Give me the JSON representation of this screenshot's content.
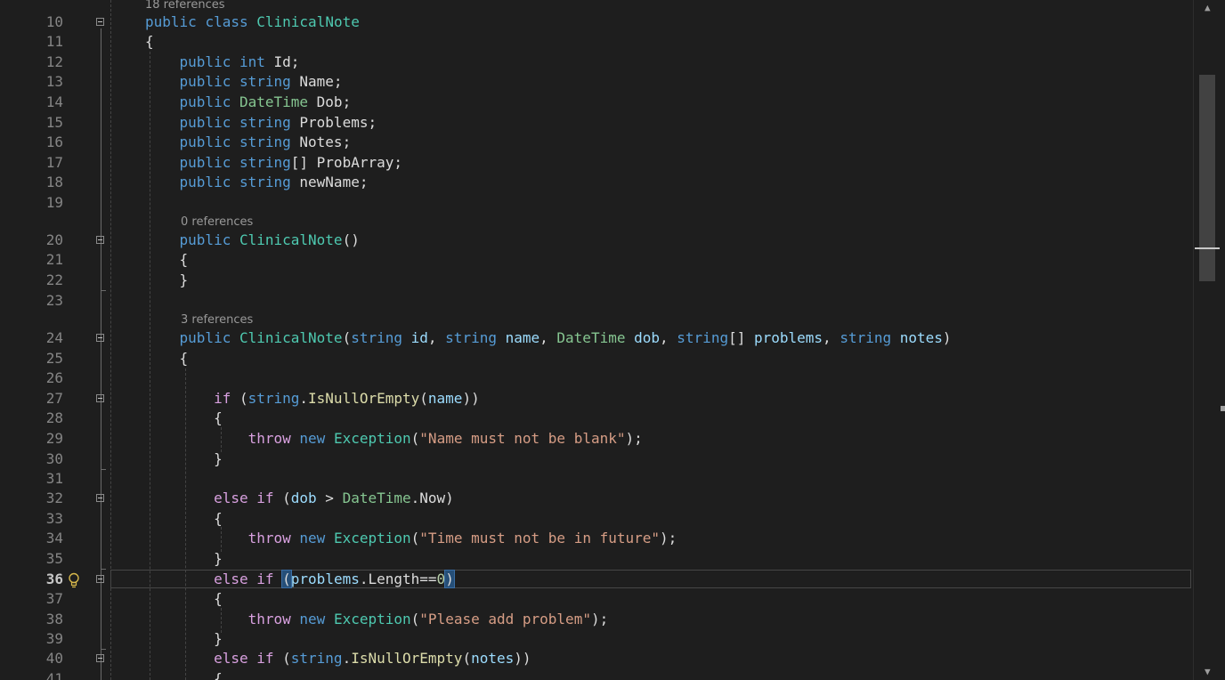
{
  "codelens": {
    "class_refs": "18 references",
    "ctor_refs": "0 references",
    "ctor2_refs": "3 references"
  },
  "lines": [
    {
      "n": "10",
      "tokens": [
        {
          "t": "public",
          "c": "kw"
        },
        {
          "t": " "
        },
        {
          "t": "class",
          "c": "kw"
        },
        {
          "t": " "
        },
        {
          "t": "ClinicalNote",
          "c": "type"
        }
      ]
    },
    {
      "n": "11",
      "tokens": [
        {
          "t": "{"
        }
      ]
    },
    {
      "n": "12",
      "tokens": [
        {
          "t": "    "
        },
        {
          "t": "public",
          "c": "kw"
        },
        {
          "t": " "
        },
        {
          "t": "int",
          "c": "kw"
        },
        {
          "t": " Id;"
        }
      ]
    },
    {
      "n": "13",
      "tokens": [
        {
          "t": "    "
        },
        {
          "t": "public",
          "c": "kw"
        },
        {
          "t": " "
        },
        {
          "t": "string",
          "c": "kw"
        },
        {
          "t": " Name;"
        }
      ]
    },
    {
      "n": "14",
      "tokens": [
        {
          "t": "    "
        },
        {
          "t": "public",
          "c": "kw"
        },
        {
          "t": " "
        },
        {
          "t": "DateTime",
          "c": "vtype"
        },
        {
          "t": " Dob;"
        }
      ]
    },
    {
      "n": "15",
      "tokens": [
        {
          "t": "    "
        },
        {
          "t": "public",
          "c": "kw"
        },
        {
          "t": " "
        },
        {
          "t": "string",
          "c": "kw"
        },
        {
          "t": " Problems;"
        }
      ]
    },
    {
      "n": "16",
      "tokens": [
        {
          "t": "    "
        },
        {
          "t": "public",
          "c": "kw"
        },
        {
          "t": " "
        },
        {
          "t": "string",
          "c": "kw"
        },
        {
          "t": " Notes;"
        }
      ]
    },
    {
      "n": "17",
      "tokens": [
        {
          "t": "    "
        },
        {
          "t": "public",
          "c": "kw"
        },
        {
          "t": " "
        },
        {
          "t": "string",
          "c": "kw"
        },
        {
          "t": "[] ProbArray;"
        }
      ]
    },
    {
      "n": "18",
      "tokens": [
        {
          "t": "    "
        },
        {
          "t": "public",
          "c": "kw"
        },
        {
          "t": " "
        },
        {
          "t": "string",
          "c": "kw"
        },
        {
          "t": " newName;"
        }
      ]
    },
    {
      "n": "19",
      "tokens": []
    },
    {
      "n": "20",
      "tokens": [
        {
          "t": "    "
        },
        {
          "t": "public",
          "c": "kw"
        },
        {
          "t": " "
        },
        {
          "t": "ClinicalNote",
          "c": "type"
        },
        {
          "t": "()"
        }
      ]
    },
    {
      "n": "21",
      "tokens": [
        {
          "t": "    {"
        }
      ]
    },
    {
      "n": "22",
      "tokens": [
        {
          "t": "    }"
        }
      ]
    },
    {
      "n": "23",
      "tokens": []
    },
    {
      "n": "24",
      "tokens": [
        {
          "t": "    "
        },
        {
          "t": "public",
          "c": "kw"
        },
        {
          "t": " "
        },
        {
          "t": "ClinicalNote",
          "c": "type"
        },
        {
          "t": "("
        },
        {
          "t": "string",
          "c": "kw"
        },
        {
          "t": " "
        },
        {
          "t": "id",
          "c": "param"
        },
        {
          "t": ", "
        },
        {
          "t": "string",
          "c": "kw"
        },
        {
          "t": " "
        },
        {
          "t": "name",
          "c": "param"
        },
        {
          "t": ", "
        },
        {
          "t": "DateTime",
          "c": "vtype"
        },
        {
          "t": " "
        },
        {
          "t": "dob",
          "c": "param"
        },
        {
          "t": ", "
        },
        {
          "t": "string",
          "c": "kw"
        },
        {
          "t": "[] "
        },
        {
          "t": "problems",
          "c": "param"
        },
        {
          "t": ", "
        },
        {
          "t": "string",
          "c": "kw"
        },
        {
          "t": " "
        },
        {
          "t": "notes",
          "c": "param"
        },
        {
          "t": ")"
        }
      ]
    },
    {
      "n": "25",
      "tokens": [
        {
          "t": "    {"
        }
      ]
    },
    {
      "n": "26",
      "tokens": []
    },
    {
      "n": "27",
      "tokens": [
        {
          "t": "        "
        },
        {
          "t": "if",
          "c": "ctl"
        },
        {
          "t": " ("
        },
        {
          "t": "string",
          "c": "kw"
        },
        {
          "t": "."
        },
        {
          "t": "IsNullOrEmpty",
          "c": "mth"
        },
        {
          "t": "("
        },
        {
          "t": "name",
          "c": "param"
        },
        {
          "t": "))"
        }
      ]
    },
    {
      "n": "28",
      "tokens": [
        {
          "t": "        {"
        }
      ]
    },
    {
      "n": "29",
      "tokens": [
        {
          "t": "            "
        },
        {
          "t": "throw",
          "c": "ctl"
        },
        {
          "t": " "
        },
        {
          "t": "new",
          "c": "kw"
        },
        {
          "t": " "
        },
        {
          "t": "Exception",
          "c": "type"
        },
        {
          "t": "("
        },
        {
          "t": "\"Name must not be blank\"",
          "c": "str"
        },
        {
          "t": ");"
        }
      ]
    },
    {
      "n": "30",
      "tokens": [
        {
          "t": "        }"
        }
      ]
    },
    {
      "n": "31",
      "tokens": []
    },
    {
      "n": "32",
      "tokens": [
        {
          "t": "        "
        },
        {
          "t": "else",
          "c": "ctl"
        },
        {
          "t": " "
        },
        {
          "t": "if",
          "c": "ctl"
        },
        {
          "t": " ("
        },
        {
          "t": "dob",
          "c": "param"
        },
        {
          "t": " > "
        },
        {
          "t": "DateTime",
          "c": "vtype"
        },
        {
          "t": ".Now)"
        }
      ]
    },
    {
      "n": "33",
      "tokens": [
        {
          "t": "        {"
        }
      ]
    },
    {
      "n": "34",
      "tokens": [
        {
          "t": "            "
        },
        {
          "t": "throw",
          "c": "ctl"
        },
        {
          "t": " "
        },
        {
          "t": "new",
          "c": "kw"
        },
        {
          "t": " "
        },
        {
          "t": "Exception",
          "c": "type"
        },
        {
          "t": "("
        },
        {
          "t": "\"Time must not be in future\"",
          "c": "str"
        },
        {
          "t": ");"
        }
      ]
    },
    {
      "n": "35",
      "tokens": [
        {
          "t": "        }"
        }
      ]
    },
    {
      "n": "36",
      "active": true,
      "tokens": [
        {
          "t": "        "
        },
        {
          "t": "else",
          "c": "ctl"
        },
        {
          "t": " "
        },
        {
          "t": "if",
          "c": "ctl"
        },
        {
          "t": " "
        },
        {
          "t": "(",
          "c": "bracket-hl"
        },
        {
          "t": "problems",
          "c": "param"
        },
        {
          "t": ".Length=="
        },
        {
          "t": "0",
          "c": "num"
        },
        {
          "t": ")",
          "c": "bracket-hl"
        }
      ]
    },
    {
      "n": "37",
      "tokens": [
        {
          "t": "        {"
        }
      ]
    },
    {
      "n": "38",
      "tokens": [
        {
          "t": "            "
        },
        {
          "t": "throw",
          "c": "ctl"
        },
        {
          "t": " "
        },
        {
          "t": "new",
          "c": "kw"
        },
        {
          "t": " "
        },
        {
          "t": "Exception",
          "c": "type"
        },
        {
          "t": "("
        },
        {
          "t": "\"Please add problem\"",
          "c": "str"
        },
        {
          "t": ");"
        }
      ]
    },
    {
      "n": "39",
      "tokens": [
        {
          "t": "        }"
        }
      ]
    },
    {
      "n": "40",
      "tokens": [
        {
          "t": "        "
        },
        {
          "t": "else",
          "c": "ctl"
        },
        {
          "t": " "
        },
        {
          "t": "if",
          "c": "ctl"
        },
        {
          "t": " ("
        },
        {
          "t": "string",
          "c": "kw"
        },
        {
          "t": "."
        },
        {
          "t": "IsNullOrEmpty",
          "c": "mth"
        },
        {
          "t": "("
        },
        {
          "t": "notes",
          "c": "param"
        },
        {
          "t": "))"
        }
      ]
    },
    {
      "n": "41",
      "tokens": [
        {
          "t": "        {"
        }
      ]
    }
  ],
  "scrollbar": {
    "up_icon": "chevron-up-icon",
    "down_icon": "chevron-down-icon"
  },
  "colors": {
    "background": "#1e1e1e",
    "keyword": "#569cd6",
    "control": "#d8a0df",
    "type": "#4ec9b0",
    "string": "#d69d85",
    "param": "#9cdcfe",
    "method": "#dcdcaa"
  }
}
